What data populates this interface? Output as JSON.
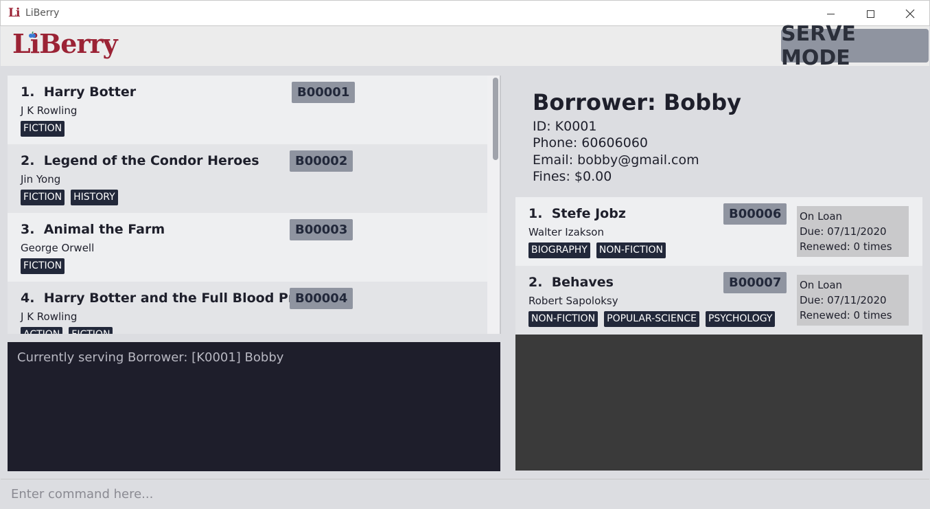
{
  "window": {
    "title": "LiBerry",
    "icon_text": "Li"
  },
  "header": {
    "logo": "LiBerry",
    "mode": "SERVE MODE"
  },
  "books": [
    {
      "index": "1.",
      "title": "Harry Botter",
      "author": "J K Rowling",
      "code": "B00001",
      "tags": [
        "FICTION"
      ]
    },
    {
      "index": "2.",
      "title": "Legend of the Condor Heroes",
      "author": "Jin Yong",
      "code": "B00002",
      "tags": [
        "FICTION",
        "HISTORY"
      ]
    },
    {
      "index": "3.",
      "title": "Animal the Farm",
      "author": "George Orwell",
      "code": "B00003",
      "tags": [
        "FICTION"
      ]
    },
    {
      "index": "4.",
      "title": "Harry Botter and the Full Blood Prince",
      "author": "J K Rowling",
      "code": "B00004",
      "tags": [
        "ACTION",
        "FICTION"
      ]
    }
  ],
  "result": {
    "text": "Currently serving Borrower: [K0001] Bobby"
  },
  "borrower": {
    "heading": "Borrower: Bobby",
    "id": "ID: K0001",
    "phone": "Phone: 60606060",
    "email": "Email: bobby@gmail.com",
    "fines": "Fines: $0.00"
  },
  "loans": [
    {
      "index": "1.",
      "title": "Stefe Jobz",
      "author": "Walter Izakson",
      "code": "B00006",
      "tags": [
        "BIOGRAPHY",
        "NON-FICTION"
      ],
      "status": "On Loan",
      "due": "Due: 07/11/2020",
      "renewed": "Renewed: 0 times"
    },
    {
      "index": "2.",
      "title": "Behaves",
      "author": "Robert Sapoloksy",
      "code": "B00007",
      "tags": [
        "NON-FICTION",
        "POPULAR-SCIENCE",
        "PSYCHOLOGY"
      ],
      "status": "On Loan",
      "due": "Due: 07/11/2020",
      "renewed": "Renewed: 0 times"
    }
  ],
  "command": {
    "placeholder": "Enter command here..."
  },
  "colors": {
    "brand": "#9b2335",
    "tag_bg": "#22283a",
    "code_bg": "#8f94a0",
    "result_bg": "#1e1e2b"
  }
}
